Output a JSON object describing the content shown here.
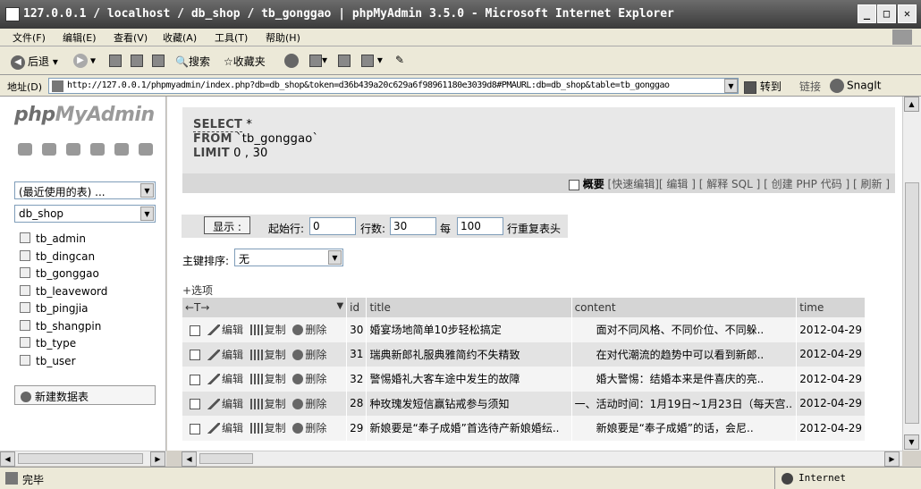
{
  "window": {
    "title": "127.0.0.1 / localhost / db_shop / tb_gonggao | phpMyAdmin 3.5.0 - Microsoft Internet Explorer"
  },
  "menu": [
    "文件(F)",
    "编辑(E)",
    "查看(V)",
    "收藏(A)",
    "工具(T)",
    "帮助(H)"
  ],
  "toolbar": {
    "back": "后退",
    "search": "搜索",
    "favorites": "收藏夹"
  },
  "address": {
    "label": "地址(D)",
    "url": "http://127.0.0.1/phpmyadmin/index.php?db=db_shop&token=d36b439a20c629a6f98961180e3039d8#PMAURL:db=db_shop&table=tb_gonggao",
    "go": "转到",
    "links": "链接",
    "snagit": "SnagIt"
  },
  "sidebar": {
    "logo_php": "php",
    "logo_admin": "MyAdmin",
    "recent": "(最近使用的表) ...",
    "db": "db_shop",
    "tables": [
      "tb_admin",
      "tb_dingcan",
      "tb_gonggao",
      "tb_leaveword",
      "tb_pingjia",
      "tb_shangpin",
      "tb_type",
      "tb_user"
    ],
    "new_db": "新建数据表"
  },
  "sql": {
    "l1_kw": "SELECT",
    "l1_rest": " *",
    "l2_kw": "FROM",
    "l2_rest": " `tb_gonggao`",
    "l3_kw": "LIMIT",
    "l3_rest": " 0 , 30"
  },
  "sql_actions": {
    "profile": "概要",
    "links": "[快速编辑][ 编辑 ] [ 解释 SQL ] [ 创建 PHP 代码 ] [ 刷新 ]"
  },
  "nav": {
    "show": "显示 :",
    "start_label": "起始行:",
    "start": "0",
    "rows_label": "行数:",
    "rows": "30",
    "every_label": "每",
    "every": "100",
    "repeat_label": "行重复表头"
  },
  "sort": {
    "label": "主键排序:",
    "value": "无"
  },
  "options": "+选项",
  "columns": {
    "arrows": "←T→",
    "id": "id",
    "title": "title",
    "content": "content",
    "time": "time"
  },
  "actions": {
    "edit": "编辑",
    "copy": "复制",
    "delete": "删除"
  },
  "rows": [
    {
      "id": "30",
      "title": "婚宴场地简单10步轻松搞定",
      "content": "　　面对不同风格、不同价位、不同躲..",
      "time": "2012-04-29"
    },
    {
      "id": "31",
      "title": "瑞典新郎礼服典雅简约不失精致",
      "content": "　　在对代潮流的趋势中可以看到新郎..",
      "time": "2012-04-29"
    },
    {
      "id": "32",
      "title": "警惕婚礼大客车途中发生的故障",
      "content": "　　婚大警惕：结婚本来是件喜庆的亮..",
      "time": "2012-04-29"
    },
    {
      "id": "28",
      "title": "种玫瑰发短信赢钻戒参与须知",
      "content": "一、活动时间：1月19日~1月23日（每天宫..",
      "time": "2012-04-29"
    },
    {
      "id": "29",
      "title": "新娘要是“奉子成婚”首选待产新娘婚纭..",
      "content": "　　新娘要是“奉子成婚”的话，会尼..",
      "time": "2012-04-29"
    }
  ],
  "status": {
    "left": "完毕",
    "zone": "Internet"
  }
}
